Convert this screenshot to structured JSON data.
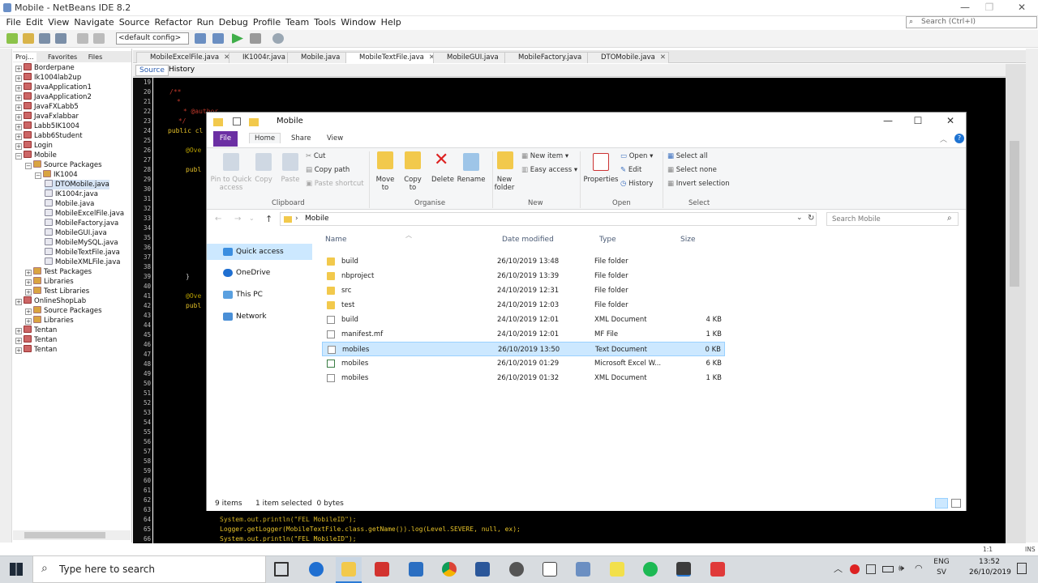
{
  "netbeans": {
    "title": "Mobile - NetBeans IDE 8.2",
    "menu": [
      "File",
      "Edit",
      "View",
      "Navigate",
      "Source",
      "Refactor",
      "Run",
      "Debug",
      "Profile",
      "Team",
      "Tools",
      "Window",
      "Help"
    ],
    "search_placeholder": "Search (Ctrl+I)",
    "config": "<default config>",
    "left_tabs": [
      "Proj...",
      "Favorites",
      "Files"
    ],
    "tree": [
      {
        "label": "Borderpane",
        "indent": 0,
        "type": "proj"
      },
      {
        "label": "Ik1004lab2up",
        "indent": 0,
        "type": "proj"
      },
      {
        "label": "JavaApplication1",
        "indent": 0,
        "type": "proj"
      },
      {
        "label": "JavaApplication2",
        "indent": 0,
        "type": "proj"
      },
      {
        "label": "JavaFXLabb5",
        "indent": 0,
        "type": "proj"
      },
      {
        "label": "JavaFxlabbar",
        "indent": 0,
        "type": "proj"
      },
      {
        "label": "Labb5IK1004",
        "indent": 0,
        "type": "proj"
      },
      {
        "label": "Labb6Student",
        "indent": 0,
        "type": "proj"
      },
      {
        "label": "Login",
        "indent": 0,
        "type": "proj"
      },
      {
        "label": "Mobile",
        "indent": 0,
        "type": "proj"
      },
      {
        "label": "Source Packages",
        "indent": 1,
        "type": "pkg"
      },
      {
        "label": "IK1004",
        "indent": 2,
        "type": "pkg"
      },
      {
        "label": "DTOMobile.java",
        "indent": 3,
        "type": "java",
        "selected": true
      },
      {
        "label": "IK1004r.java",
        "indent": 3,
        "type": "java"
      },
      {
        "label": "Mobile.java",
        "indent": 3,
        "type": "java"
      },
      {
        "label": "MobileExcelFile.java",
        "indent": 3,
        "type": "java"
      },
      {
        "label": "MobileFactory.java",
        "indent": 3,
        "type": "java"
      },
      {
        "label": "MobileGUI.java",
        "indent": 3,
        "type": "java"
      },
      {
        "label": "MobileMySQL.java",
        "indent": 3,
        "type": "java"
      },
      {
        "label": "MobileTextFile.java",
        "indent": 3,
        "type": "java"
      },
      {
        "label": "MobileXMLFile.java",
        "indent": 3,
        "type": "java"
      },
      {
        "label": "Test Packages",
        "indent": 1,
        "type": "pkg"
      },
      {
        "label": "Libraries",
        "indent": 1,
        "type": "pkg"
      },
      {
        "label": "Test Libraries",
        "indent": 1,
        "type": "pkg"
      },
      {
        "label": "OnlineShopLab",
        "indent": 0,
        "type": "proj"
      },
      {
        "label": "Source Packages",
        "indent": 1,
        "type": "pkg"
      },
      {
        "label": "Libraries",
        "indent": 1,
        "type": "pkg"
      },
      {
        "label": "Tentan",
        "indent": 0,
        "type": "proj"
      },
      {
        "label": "Tentan",
        "indent": 0,
        "type": "proj"
      },
      {
        "label": "Tentan",
        "indent": 0,
        "type": "proj"
      }
    ],
    "editor_tabs": [
      "MobileExcelFile.java",
      "IK1004r.java",
      "Mobile.java",
      "MobileTextFile.java",
      "MobileGUI.java",
      "MobileFactory.java",
      "DTOMobile.java"
    ],
    "active_tab": "MobileTextFile.java",
    "source_label": "Source",
    "history_label": "History",
    "line_numbers": [
      "19",
      "20",
      "21",
      "22",
      "23",
      "24",
      "25",
      "26",
      "27",
      "28",
      "29",
      "30",
      "31",
      "32",
      "33",
      "34",
      "35",
      "36",
      "37",
      "38",
      "39",
      "40",
      "41",
      "42",
      "43",
      "44",
      "45",
      "46",
      "47",
      "48",
      "49",
      "50",
      "51",
      "52",
      "53",
      "54",
      "55",
      "56",
      "57",
      "58",
      "59",
      "60",
      "61",
      "62",
      "63",
      "64",
      "65",
      "66"
    ],
    "code_visible": [
      {
        "text": "/**",
        "color": "#c0392b"
      },
      {
        "text": " *",
        "color": "#c0392b"
      },
      {
        "text": " * @author",
        "color": "#c0392b"
      },
      {
        "text": " */",
        "color": "#c0392b"
      },
      {
        "text": "public cl",
        "color": "#e6c229"
      },
      {
        "text": "@Ove",
        "color": "#b8a000"
      },
      {
        "text": "publ",
        "color": "#e6c229"
      },
      {
        "text": "}",
        "color": "#c9c9c9"
      },
      {
        "text": "@Ove",
        "color": "#b8a000"
      },
      {
        "text": "publ",
        "color": "#e6c229"
      },
      {
        "text": "System.out.println(\"FEL MobileID\");",
        "color": "#e6c229"
      },
      {
        "text": "Logger.getLogger(MobileTextFile.class.getName()).log(Level.SEVERE, null, ex);",
        "color": "#e6c229"
      },
      {
        "text": "System.out.println(\"FEL MobileID\");",
        "color": "#e6c229"
      }
    ],
    "zoom": "1:1",
    "ins": "INS"
  },
  "explorer": {
    "title": "Mobile",
    "ribbon_tabs": [
      "File",
      "Home",
      "Share",
      "View"
    ],
    "clipboard": {
      "pin": "Pin to Quick access",
      "copy": "Copy",
      "paste": "Paste",
      "cut": "Cut",
      "copy_path": "Copy path",
      "paste_shortcut": "Paste shortcut",
      "group": "Clipboard"
    },
    "organise": {
      "move_to": "Move to",
      "copy_to": "Copy to",
      "delete": "Delete",
      "rename": "Rename",
      "group": "Organise"
    },
    "new": {
      "new_folder": "New folder",
      "new_item": "New item",
      "easy_access": "Easy access",
      "group": "New"
    },
    "open": {
      "properties": "Properties",
      "open": "Open",
      "edit": "Edit",
      "history": "History",
      "group": "Open"
    },
    "select": {
      "select_all": "Select all",
      "select_none": "Select none",
      "invert": "Invert selection",
      "group": "Select"
    },
    "address": "Mobile",
    "search_placeholder": "Search Mobile",
    "nav": [
      "Quick access",
      "OneDrive",
      "This PC",
      "Network"
    ],
    "columns": [
      "Name",
      "Date modified",
      "Type",
      "Size"
    ],
    "files": [
      {
        "name": "build",
        "date": "26/10/2019 13:48",
        "type": "File folder",
        "size": "",
        "icon": "folder"
      },
      {
        "name": "nbproject",
        "date": "26/10/2019 13:39",
        "type": "File folder",
        "size": "",
        "icon": "folder"
      },
      {
        "name": "src",
        "date": "24/10/2019 12:31",
        "type": "File folder",
        "size": "",
        "icon": "folder"
      },
      {
        "name": "test",
        "date": "24/10/2019 12:03",
        "type": "File folder",
        "size": "",
        "icon": "folder"
      },
      {
        "name": "build",
        "date": "24/10/2019 12:01",
        "type": "XML Document",
        "size": "4 KB",
        "icon": "doc"
      },
      {
        "name": "manifest.mf",
        "date": "24/10/2019 12:01",
        "type": "MF File",
        "size": "1 KB",
        "icon": "doc"
      },
      {
        "name": "mobiles",
        "date": "26/10/2019 13:50",
        "type": "Text Document",
        "size": "0 KB",
        "icon": "doc",
        "selected": true
      },
      {
        "name": "mobiles",
        "date": "26/10/2019 01:29",
        "type": "Microsoft Excel W...",
        "size": "6 KB",
        "icon": "xl"
      },
      {
        "name": "mobiles",
        "date": "26/10/2019 01:32",
        "type": "XML Document",
        "size": "1 KB",
        "icon": "doc"
      }
    ],
    "status_items": "9 items",
    "status_selected": "1 item selected  0 bytes"
  },
  "taskbar": {
    "search_placeholder": "Type here to search",
    "lang": "ENG",
    "lang2": "SV",
    "time": "13:52",
    "date": "26/10/2019"
  }
}
